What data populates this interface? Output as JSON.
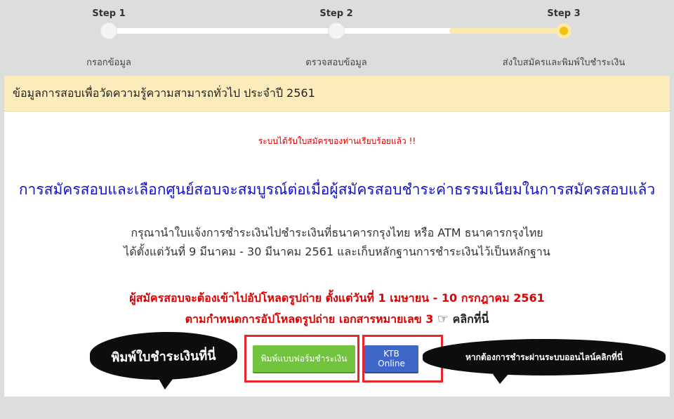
{
  "stepper": {
    "steps": [
      {
        "title": "Step 1",
        "label": "กรอกข้อมูล"
      },
      {
        "title": "Step 2",
        "label": "ตรวจสอบข้อมูล"
      },
      {
        "title": "Step 3",
        "label": "ส่งใบสมัครและพิมพ์ใบชำระเงิน"
      }
    ],
    "active_step": 3
  },
  "panel": {
    "header": "ข้อมูลการสอบเพื่อวัดความรู้ความสามารถทั่วไป ประจำปี 2561",
    "notice": "ระบบได้รับใบสมัครของท่านเรียบร้อยแล้ว !!",
    "headline": "การสมัครสอบและเลือกศูนย์สอบจะสมบูรณ์ต่อเมื่อผู้สมัครสอบชำระค่าธรรมเนียมในการสมัครสอบแล้ว",
    "info_line1": "กรุณานำใบแจ้งการชำระเงินไปชำระเงินที่ธนาคารกรุงไทย หรือ ATM ธนาคารกรุงไทย",
    "info_line2": "ได้ตั้งแต่วันที่ 9 มีนาคม - 30 มีนาคม 2561 และเก็บหลักฐานการชำระเงินไว้เป็นหลักฐาน",
    "upload_line1": "ผู้สมัครสอบจะต้องเข้าไปอัปโหลดรูปถ่าย ตั้งแต่วันที่ 1 เมษายน - 10 กรกฎาคม 2561",
    "upload_line2": "ตามกำหนดการอัปโหลดรูปถ่าย เอกสารหมายเลข 3",
    "click_here": "คลิกที่นี่"
  },
  "actions": {
    "bubble_left": "พิมพ์ใบชำระเงินที่นี่",
    "print_button": "พิมพ์แบบฟอร์มชำระเงิน",
    "ktb_button": "KTB Online",
    "bubble_right": "หากต้องการชำระผ่านระบบออนไลน์คลิกที่นี่"
  },
  "colors": {
    "header_bg": "#fcecbc",
    "notice": "#d30000",
    "headline": "#1111cc",
    "print_button": "#72c43e",
    "ktb_button": "#3f66c9",
    "highlight_box": "#e8262b"
  }
}
